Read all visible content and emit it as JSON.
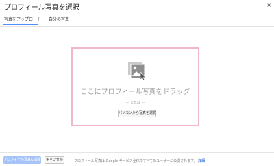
{
  "dialog": {
    "title": "プロフィール写真を選択",
    "close_label": "×"
  },
  "tabs": [
    {
      "label": "写真をアップロード",
      "active": true
    },
    {
      "label": "自分の写真",
      "active": false
    }
  ],
  "dropzone": {
    "icon": "photo-icon",
    "drop_text": "ここにプロフィール写真をドラッグ",
    "or_text": "－ または －",
    "select_button": "パソコンから写真を選択"
  },
  "footer": {
    "set_button": "プロフィール写真に設定",
    "cancel_button": "キャンセル",
    "notice_text": "プロフィール写真は Google サービス全体ですべてのユーザーに公開されます。",
    "notice_link": "詳細"
  },
  "colors": {
    "accent": "#4d90fe",
    "dropzone_border": "#f0b8c8",
    "primary_button_disabled": "#a6c4f7",
    "link": "#1155cc"
  }
}
